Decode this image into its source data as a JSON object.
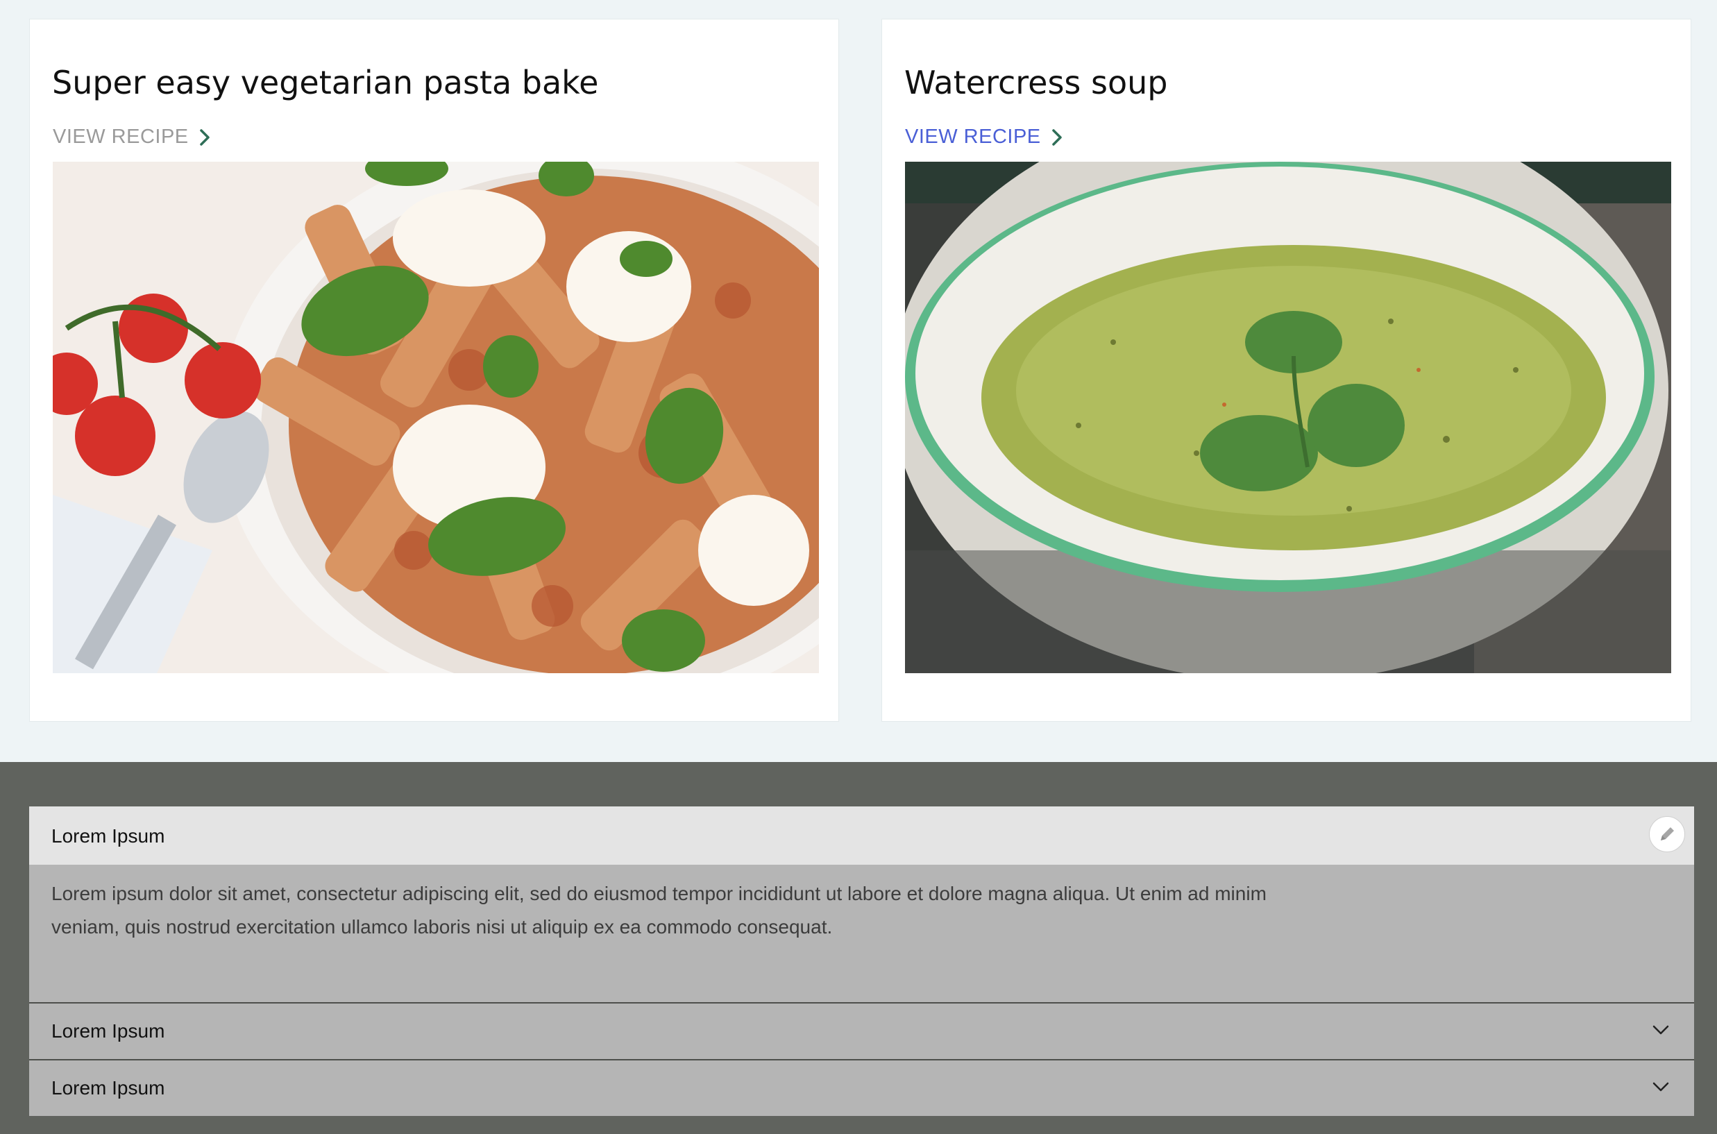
{
  "recipes": [
    {
      "title": "Super easy vegetarian pasta bake",
      "link_label": "VIEW RECIPE",
      "link_color": "#9a9a9a",
      "image_subject": "pasta bake with basil, mozzarella and cherry tomatoes"
    },
    {
      "title": "Watercress soup",
      "link_label": "VIEW RECIPE",
      "link_color": "#4a5fd6",
      "image_subject": "bowl of green watercress soup with herb garnish"
    }
  ],
  "accordion": {
    "background": "#60635e",
    "open_item": {
      "title": "Lorem Ipsum",
      "body": "Lorem ipsum dolor sit amet, consectetur adipiscing elit, sed do eiusmod tempor incididunt ut labore et dolore magna aliqua. Ut enim ad minim veniam, quis nostrud exercitation ullamco laboris nisi ut aliquip ex ea commodo consequat.",
      "action_icon": "pencil-icon"
    },
    "collapsed_items": [
      {
        "title": "Lorem Ipsum",
        "icon": "chevron-down-icon"
      },
      {
        "title": "Lorem Ipsum",
        "icon": "chevron-down-icon"
      }
    ]
  }
}
